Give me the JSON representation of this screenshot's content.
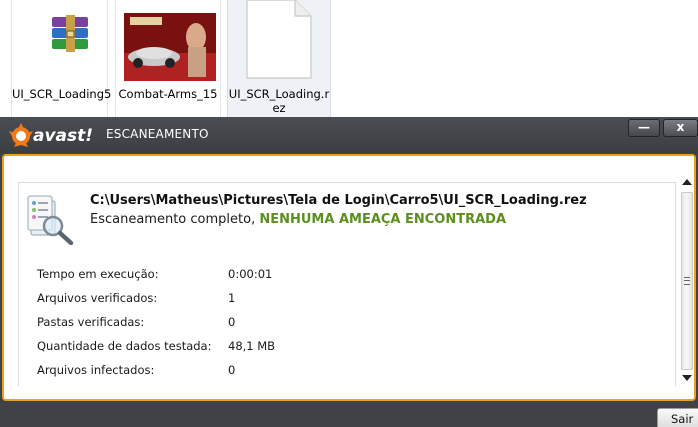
{
  "explorer": {
    "files": [
      {
        "name": "UI_SCR_Loading5",
        "icon": "winrar-archive-icon"
      },
      {
        "name": "Combat-Arms_15",
        "icon": "image-thumbnail"
      },
      {
        "name_line1": "UI_SCR_Loading.r",
        "name_line2": "ez",
        "icon": "blank-file-icon"
      }
    ]
  },
  "window": {
    "logo_text": "avast!",
    "title": "ESCANEAMENTO",
    "minimize_label": "—",
    "close_label": "x"
  },
  "scan": {
    "path": "C:\\Users\\Matheus\\Pictures\\Tela de Login\\Carro5\\UI_SCR_Loading.rez",
    "status_prefix": "Escaneamento completo,",
    "status_result": "NENHUMA AMEAÇA ENCONTRADA",
    "stats": [
      {
        "label": "Tempo em execução:",
        "value": "0:00:01"
      },
      {
        "label": "Arquivos verificados:",
        "value": "1"
      },
      {
        "label": "Pastas verificadas:",
        "value": "0"
      },
      {
        "label": "Quantidade de dados testada:",
        "value": "48,1 MB"
      },
      {
        "label": "Arquivos infectados:",
        "value": "0"
      }
    ]
  },
  "buttons": {
    "exit_label": "Sair"
  },
  "colors": {
    "accent": "#e8a21b",
    "success": "#5b8f1f",
    "titlebar": "#3f4347"
  }
}
